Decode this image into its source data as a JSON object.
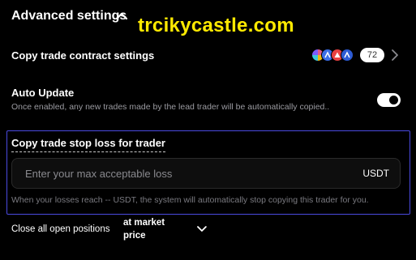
{
  "header": {
    "title": "Advanced settings"
  },
  "watermark": {
    "text": "trcikycastle.com",
    "color": "#ffea00"
  },
  "contract_settings": {
    "label": "Copy trade contract settings",
    "coins": [
      {
        "icon": "multi-color-coin-icon",
        "color": "#e05a8a"
      },
      {
        "icon": "arrow-coin-icon",
        "color": "#3b6ee8"
      },
      {
        "icon": "avax-coin-icon",
        "color": "#e84142"
      },
      {
        "icon": "arrow-coin-icon",
        "color": "#3b6ee8"
      }
    ],
    "count": "72"
  },
  "auto_update": {
    "label": "Auto Update",
    "description": "Once enabled, any new trades made by the lead trader will be automatically copied..",
    "enabled": true
  },
  "stop_loss": {
    "title": "Copy trade stop loss for trader",
    "placeholder": "Enter your max acceptable loss",
    "value": "",
    "unit": "USDT",
    "hint": "When your losses reach -- USDT, the system will automatically stop copying this trader for you."
  },
  "close_positions": {
    "label": "Close all open positions",
    "selected": "at market price"
  },
  "colors": {
    "background": "#000000",
    "accent_border": "#4a4ae0",
    "muted_text": "#9a9aa0"
  }
}
